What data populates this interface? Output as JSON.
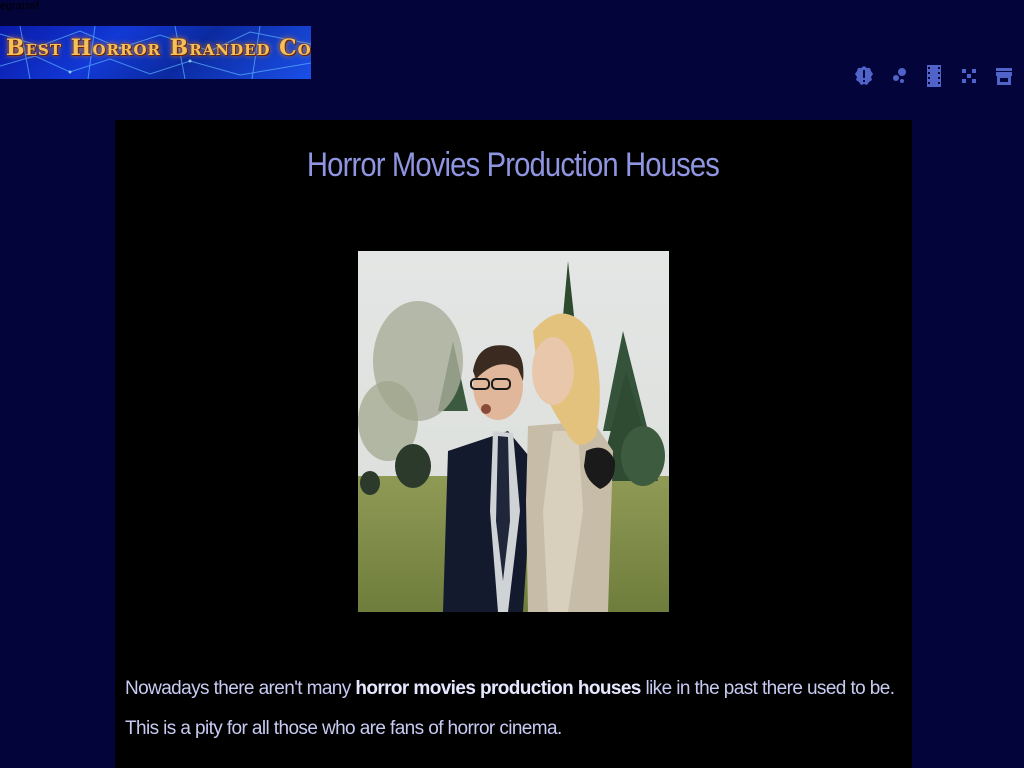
{
  "page": {
    "top_fragment": "egranwf"
  },
  "header": {
    "logo_text": "Best Horror Branded Content",
    "icons": [
      {
        "name": "alert-icon",
        "color": "#4f63c8"
      },
      {
        "name": "dots-icon",
        "color": "#4f63c8"
      },
      {
        "name": "film-icon",
        "color": "#4f63c8"
      },
      {
        "name": "grid-icon",
        "color": "#4f63c8"
      },
      {
        "name": "store-icon",
        "color": "#4f63c8"
      }
    ]
  },
  "article": {
    "title": "Horror Movies Production Houses",
    "photo_alt_icon": "film-still-image",
    "paragraph_before": "Nowadays there aren't many ",
    "paragraph_bold": "horror movies production houses",
    "paragraph_after": " like in the past there used to be. This is a pity for all those who are fans of horror cinema."
  },
  "colors": {
    "page_background": "#03053a",
    "content_background": "#000000",
    "title": "#8f95e0",
    "body_text": "#c7cbf2",
    "icons": "#4f63c8"
  }
}
